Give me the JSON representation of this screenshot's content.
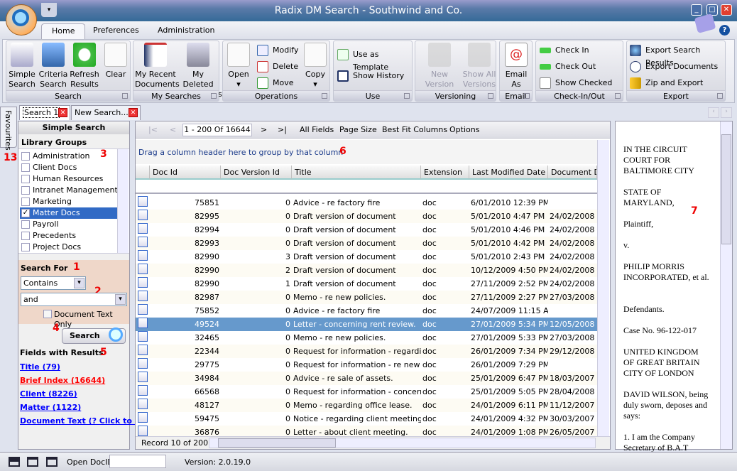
{
  "window": {
    "title": "Radix DM Search - Southwind and Co.",
    "minimize": "_",
    "maximize": "□",
    "close": "✕",
    "qat": "▾"
  },
  "ribbon_tabs": [
    "Home",
    "Preferences",
    "Administration"
  ],
  "groups": {
    "search": {
      "label": "Search",
      "buttons": [
        "Simple Search",
        "Criteria Search",
        "Refresh Results",
        "Clear"
      ]
    },
    "my_searches": {
      "label": "My Searches",
      "buttons": [
        "My Recent Documents",
        "My Deleted Documents"
      ]
    },
    "operations": {
      "label": "Operations",
      "open": "Open",
      "copy": "Copy",
      "modify": "Modify",
      "delete": "Delete",
      "move": "Move"
    },
    "use": {
      "label": "Use",
      "use_as_template": "Use as Template",
      "show_history": "Show History"
    },
    "versioning": {
      "label": "Versioning",
      "new_version": "New Version",
      "show_all_versions": "Show All Versions"
    },
    "email": {
      "label": "Email",
      "email_as": "Email As"
    },
    "checkinout": {
      "label": "Check-In/Out",
      "check_in": "Check In",
      "check_out": "Check Out",
      "show_checked_out": "Show Checked Out"
    },
    "export": {
      "label": "Export",
      "export_search_results": "Export Search Results",
      "export_documents": "Export Documents",
      "zip_and_export": "Zip and Export"
    }
  },
  "doc_tabs": [
    "Search 1",
    "New Search..."
  ],
  "favourites": "Favourites",
  "annotations": {
    "n1": "1",
    "n2": "2",
    "n3": "3",
    "n4": "4",
    "n5": "5",
    "n6": "6",
    "n7": "7",
    "n13": "13"
  },
  "left": {
    "header": "Simple Search",
    "library_groups_label": "Library Groups",
    "library_groups": [
      {
        "label": "Administration",
        "checked": false
      },
      {
        "label": "Client Docs",
        "checked": false
      },
      {
        "label": "Human Resources",
        "checked": false
      },
      {
        "label": "Intranet Management",
        "checked": false
      },
      {
        "label": "Marketing",
        "checked": false
      },
      {
        "label": "Matter Docs",
        "checked": true
      },
      {
        "label": "Payroll",
        "checked": false
      },
      {
        "label": "Precedents",
        "checked": false
      },
      {
        "label": "Project Docs",
        "checked": false
      }
    ],
    "search_for_label": "Search For",
    "match_mode": "Contains",
    "search_text": "and",
    "doc_text_only": "Document Text Only",
    "search_button": "Search",
    "fields_label": "Fields with Results",
    "fields": [
      {
        "label": "Title (79)",
        "color": "#0000ff"
      },
      {
        "label": "Brief Index (16644)",
        "color": "#ff0000"
      },
      {
        "label": "Client (8226)",
        "color": "#0000ff"
      },
      {
        "label": "Matter (1122)",
        "color": "#0000ff"
      },
      {
        "label": "Document Text (? Click to S",
        "color": "#0000ff"
      }
    ]
  },
  "grid": {
    "toolbar": {
      "first": "|<",
      "prev": "<",
      "range": "1 - 200 Of 16644",
      "next": ">",
      "last": ">|",
      "all_fields": "All Fields",
      "page_size": "Page Size",
      "best_fit": "Best Fit Columns",
      "options": "Options"
    },
    "group_hint": "Drag a column header here to group by that column",
    "columns": [
      "Doc Id",
      "Doc Version Id",
      "Title",
      "Extension",
      "Last Modified Date",
      "Document Da"
    ],
    "rows": [
      [
        "75851",
        "0",
        "Advice - re factory fire",
        "doc",
        "6/01/2010 12:39 PM",
        ""
      ],
      [
        "82995",
        "0",
        "Draft version of document",
        "doc",
        "5/01/2010 4:47 PM",
        "24/02/2008"
      ],
      [
        "82994",
        "0",
        "Draft version of document",
        "doc",
        "5/01/2010 4:46 PM",
        "24/02/2008"
      ],
      [
        "82993",
        "0",
        "Draft version of document",
        "doc",
        "5/01/2010 4:42 PM",
        "24/02/2008"
      ],
      [
        "82990",
        "3",
        "Draft version of document",
        "doc",
        "5/01/2010 2:43 PM",
        "24/02/2008"
      ],
      [
        "82990",
        "2",
        "Draft version of document",
        "doc",
        "10/12/2009 4:50 PM",
        "24/02/2008"
      ],
      [
        "82990",
        "1",
        "Draft version of document",
        "doc",
        "27/11/2009 2:52 PM",
        "24/02/2008"
      ],
      [
        "82987",
        "0",
        "Memo - re new policies.",
        "doc",
        "27/11/2009 2:27 PM",
        "27/03/2008"
      ],
      [
        "75852",
        "0",
        "Advice - re factory fire",
        "doc",
        "24/07/2009 11:15 AM",
        ""
      ],
      [
        "49524",
        "0",
        "Letter - concerning rent review.",
        "doc",
        "27/01/2009 5:34 PM",
        "12/05/2008"
      ],
      [
        "32465",
        "0",
        "Memo - re new policies.",
        "doc",
        "27/01/2009 5:33 PM",
        "27/03/2008"
      ],
      [
        "22344",
        "0",
        "Request for information - regarding",
        "doc",
        "26/01/2009 7:34 PM",
        "29/12/2008"
      ],
      [
        "29775",
        "0",
        "Request for information - re new",
        "doc",
        "26/01/2009 7:29 PM",
        ""
      ],
      [
        "34984",
        "0",
        "Advice - re sale of assets.",
        "doc",
        "25/01/2009 6:47 PM",
        "18/03/2007"
      ],
      [
        "66568",
        "0",
        "Request for information - concerning",
        "doc",
        "25/01/2009 5:05 PM",
        "28/04/2008"
      ],
      [
        "48127",
        "0",
        "Memo - regarding office lease.",
        "doc",
        "24/01/2009 6:11 PM",
        "11/12/2007"
      ],
      [
        "59475",
        "0",
        "Notice - regarding client meeting.",
        "doc",
        "24/01/2009 4:32 PM",
        "30/03/2007"
      ],
      [
        "36876",
        "0",
        "Letter - about client meeting.",
        "doc",
        "24/01/2009 1:08 PM",
        "26/05/2007"
      ]
    ],
    "selected_row": 9,
    "record_status": "Record 10 of 200"
  },
  "preview": {
    "text": "IN THE CIRCUIT\nCOURT FOR\nBALTIMORE CITY\n\nSTATE OF\nMARYLAND,\n\nPlaintiff,\n\nv.\n\nPHILIP MORRIS\nINCORPORATED, et al.\n\n\nDefendants.\n\nCase No. 96-122-017\n\nUNITED KINGDOM\nOF GREAT BRITAIN\nCITY OF LONDON\n\nDAVID WILSON, being\nduly sworn, deposes and\nsays:\n\n1. I am the Company\nSecretary of B.A.T"
  },
  "status": {
    "open_docid_label": "Open DocID",
    "open_docid_value": "",
    "version": "Version: 2.0.19.0"
  }
}
